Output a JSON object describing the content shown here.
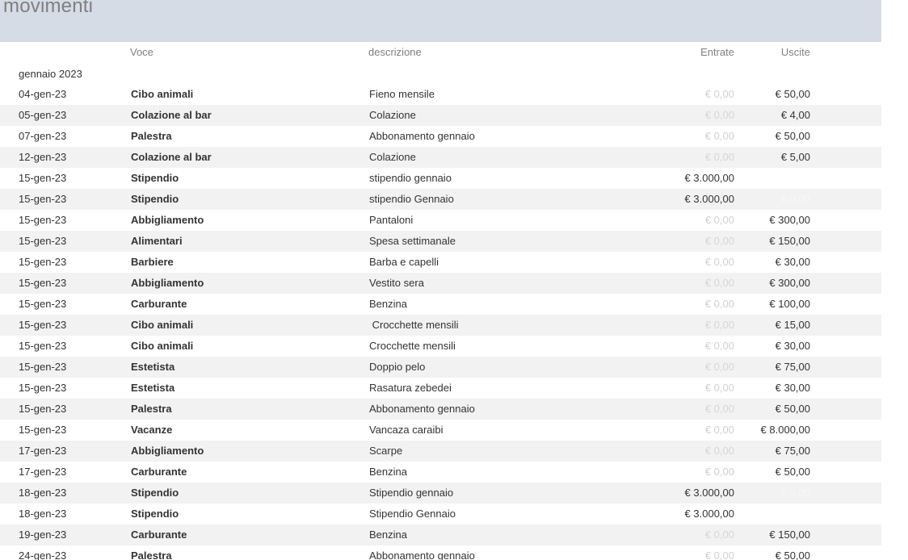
{
  "report": {
    "title": "movimenti",
    "columns": {
      "voce": "Voce",
      "descrizione": "descrizione",
      "entrate": "Entrate",
      "uscite": "Uscite"
    },
    "group_label": "gennaio 2023",
    "rows": [
      {
        "data": "04-gen-23",
        "voce": "Cibo animali",
        "descrizione": "Fieno mensile",
        "entrate": "€ 0,00",
        "uscite": "€ 50,00"
      },
      {
        "data": "05-gen-23",
        "voce": "Colazione al bar",
        "descrizione": "Colazione",
        "entrate": "€ 0,00",
        "uscite": "€ 4,00"
      },
      {
        "data": "07-gen-23",
        "voce": "Palestra",
        "descrizione": "Abbonamento gennaio",
        "entrate": "€ 0,00",
        "uscite": "€ 50,00"
      },
      {
        "data": "12-gen-23",
        "voce": "Colazione al bar",
        "descrizione": "Colazione",
        "entrate": "€ 0,00",
        "uscite": "€ 5,00"
      },
      {
        "data": "15-gen-23",
        "voce": "Stipendio",
        "descrizione": "stipendio gennaio",
        "entrate": "€ 3.000,00",
        "uscite": ""
      },
      {
        "data": "15-gen-23",
        "voce": "Stipendio",
        "descrizione": "stipendio Gennaio",
        "entrate": "€ 3.000,00",
        "uscite": "€ 0,00"
      },
      {
        "data": "15-gen-23",
        "voce": "Abbigliamento",
        "descrizione": "Pantaloni",
        "entrate": "€ 0,00",
        "uscite": "€ 300,00"
      },
      {
        "data": "15-gen-23",
        "voce": "Alimentari",
        "descrizione": "Spesa settimanale",
        "entrate": "€ 0,00",
        "uscite": "€ 150,00"
      },
      {
        "data": "15-gen-23",
        "voce": "Barbiere",
        "descrizione": "Barba e capelli",
        "entrate": "€ 0,00",
        "uscite": "€ 30,00"
      },
      {
        "data": "15-gen-23",
        "voce": "Abbigliamento",
        "descrizione": "Vestito sera",
        "entrate": "€ 0,00",
        "uscite": "€ 300,00"
      },
      {
        "data": "15-gen-23",
        "voce": "Carburante",
        "descrizione": "Benzina",
        "entrate": "€ 0,00",
        "uscite": "€ 100,00"
      },
      {
        "data": "15-gen-23",
        "voce": "Cibo animali",
        "descrizione": " Crocchette mensili",
        "entrate": "€ 0,00",
        "uscite": "€ 15,00"
      },
      {
        "data": "15-gen-23",
        "voce": "Cibo animali",
        "descrizione": "Crocchette mensili",
        "entrate": "€ 0,00",
        "uscite": "€ 30,00"
      },
      {
        "data": "15-gen-23",
        "voce": "Estetista",
        "descrizione": "Doppio pelo",
        "entrate": "€ 0,00",
        "uscite": "€ 75,00"
      },
      {
        "data": "15-gen-23",
        "voce": "Estetista",
        "descrizione": "Rasatura zebedei",
        "entrate": "€ 0,00",
        "uscite": "€ 30,00"
      },
      {
        "data": "15-gen-23",
        "voce": "Palestra",
        "descrizione": "Abbonamento gennaio",
        "entrate": "€ 0,00",
        "uscite": "€ 50,00"
      },
      {
        "data": "15-gen-23",
        "voce": "Vacanze",
        "descrizione": "Vancaza caraibi",
        "entrate": "€ 0,00",
        "uscite": "€ 8.000,00"
      },
      {
        "data": "17-gen-23",
        "voce": "Abbigliamento",
        "descrizione": "Scarpe",
        "entrate": "€ 0,00",
        "uscite": "€ 75,00"
      },
      {
        "data": "17-gen-23",
        "voce": "Carburante",
        "descrizione": "Benzina",
        "entrate": "€ 0,00",
        "uscite": "€ 50,00"
      },
      {
        "data": "18-gen-23",
        "voce": "Stipendio",
        "descrizione": "Stipendio gennaio",
        "entrate": "€ 3.000,00",
        "uscite": "€ 0,00"
      },
      {
        "data": "18-gen-23",
        "voce": "Stipendio",
        "descrizione": "Stipendio Gennaio",
        "entrate": "€ 3.000,00",
        "uscite": ""
      },
      {
        "data": "19-gen-23",
        "voce": "Carburante",
        "descrizione": "Benzina",
        "entrate": "€ 0,00",
        "uscite": "€ 150,00"
      },
      {
        "data": "24-gen-23",
        "voce": "Palestra",
        "descrizione": "Abbonamento gennaio",
        "entrate": "€ 0,00",
        "uscite": "€ 50,00"
      }
    ]
  }
}
